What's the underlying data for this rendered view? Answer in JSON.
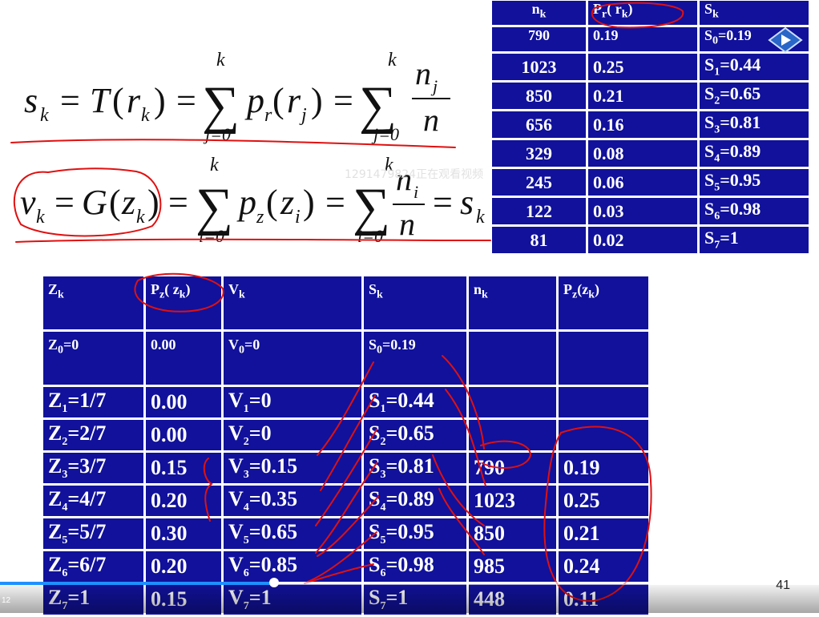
{
  "formulas": {
    "top": "s_k = T(r_k) = Σ_{j=0}^{k} p_r(r_j) = Σ_{j=0}^{k} n_j / n",
    "bottom": "v_k = G(z_k) = Σ_{i=0}^{k} p_z(z_i) = Σ_{i=0}^{k} n_i / n = s_k"
  },
  "watermark": "1291479824正在观看视频",
  "top_table": {
    "headers": [
      "nk",
      "Pr( rk)",
      "Sk"
    ],
    "rows": [
      [
        "790",
        "0.19",
        "S0=0.19"
      ],
      [
        "1023",
        "0.25",
        "S1=0.44"
      ],
      [
        "850",
        "0.21",
        "S2=0.65"
      ],
      [
        "656",
        "0.16",
        "S3=0.81"
      ],
      [
        "329",
        "0.08",
        "S4=0.89"
      ],
      [
        "245",
        "0.06",
        "S5=0.95"
      ],
      [
        "122",
        "0.03",
        "S6=0.98"
      ],
      [
        "81",
        "0.02",
        "S7=1"
      ]
    ]
  },
  "bottom_table": {
    "headers": [
      "Zk",
      "Pz( zk)",
      "Vk",
      "Sk",
      "nk",
      "Pz(zk)"
    ],
    "rows": [
      [
        "Z0=0",
        "0.00",
        "V0=0",
        "S0=0.19",
        "",
        ""
      ],
      [
        "Z1=1/7",
        "0.00",
        "V1=0",
        "S1=0.44",
        "",
        ""
      ],
      [
        "Z2=2/7",
        "0.00",
        "V2=0",
        "S2=0.65",
        "",
        ""
      ],
      [
        "Z3=3/7",
        "0.15",
        "V3=0.15",
        "S3=0.81",
        "790",
        "0.19"
      ],
      [
        "Z4=4/7",
        "0.20",
        "V4=0.35",
        "S4=0.89",
        "1023",
        "0.25"
      ],
      [
        "Z5=5/7",
        "0.30",
        "V5=0.65",
        "S5=0.95",
        "850",
        "0.21"
      ],
      [
        "Z6=6/7",
        "0.20",
        "V6=0.85",
        "S6=0.98",
        "985",
        "0.24"
      ],
      [
        "Z7=1",
        "0.15",
        "V7=1",
        "S7=1",
        "448",
        "0.11"
      ]
    ]
  },
  "player": {
    "time_left": "12",
    "page_number": "41",
    "progress": 0.335,
    "accent": "#1e90ff"
  },
  "colors": {
    "table_bg": "#11119b",
    "annotation": "#e01010"
  }
}
